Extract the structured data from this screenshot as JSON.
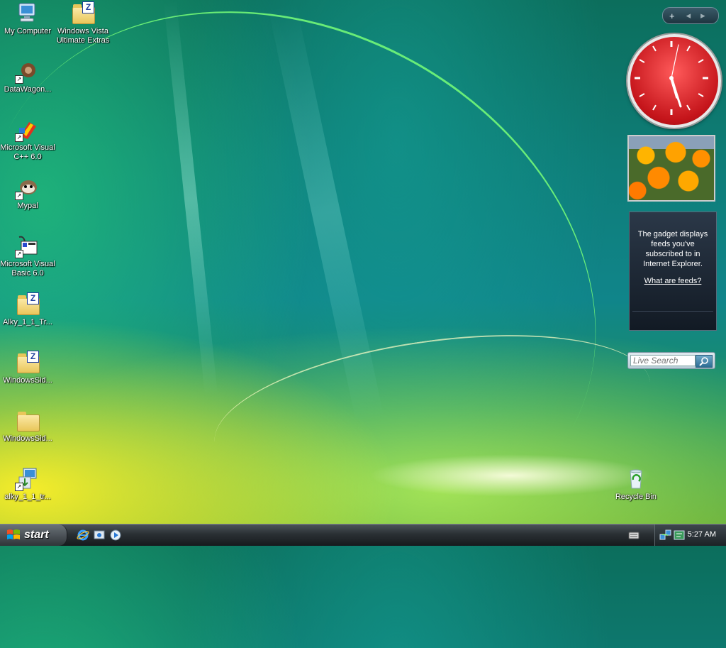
{
  "desktop": {
    "icons": [
      {
        "label": "My Computer"
      },
      {
        "label": "Windows Vista Ultimate Extras"
      },
      {
        "label": "DataWagon..."
      },
      {
        "label": "Microsoft Visual C++ 6.0"
      },
      {
        "label": "Mypal"
      },
      {
        "label": "Microsoft Visual Basic 6.0"
      },
      {
        "label": "Alky_1_1_Tr..."
      },
      {
        "label": "WindowsSid..."
      },
      {
        "label": "WindowsSid..."
      },
      {
        "label": "alky_1_1_tr..."
      },
      {
        "label": "Recycle Bin"
      }
    ]
  },
  "sidebar": {
    "add_symbol": "+",
    "prev_symbol": "◂",
    "next_symbol": "▸",
    "clock": {
      "hour": 5,
      "minute": 27,
      "second": 2
    },
    "feeds": {
      "message": "The gadget displays feeds you've subscribed to in Internet Explorer.",
      "link": "What are feeds?"
    },
    "search": {
      "placeholder": "Live Search"
    }
  },
  "taskbar": {
    "start_label": "start",
    "clock": "5:27 AM"
  },
  "colors": {
    "taskbar": "#2a3034",
    "clock_face": "#c4141a",
    "feeds_bg": "#1a2430"
  }
}
